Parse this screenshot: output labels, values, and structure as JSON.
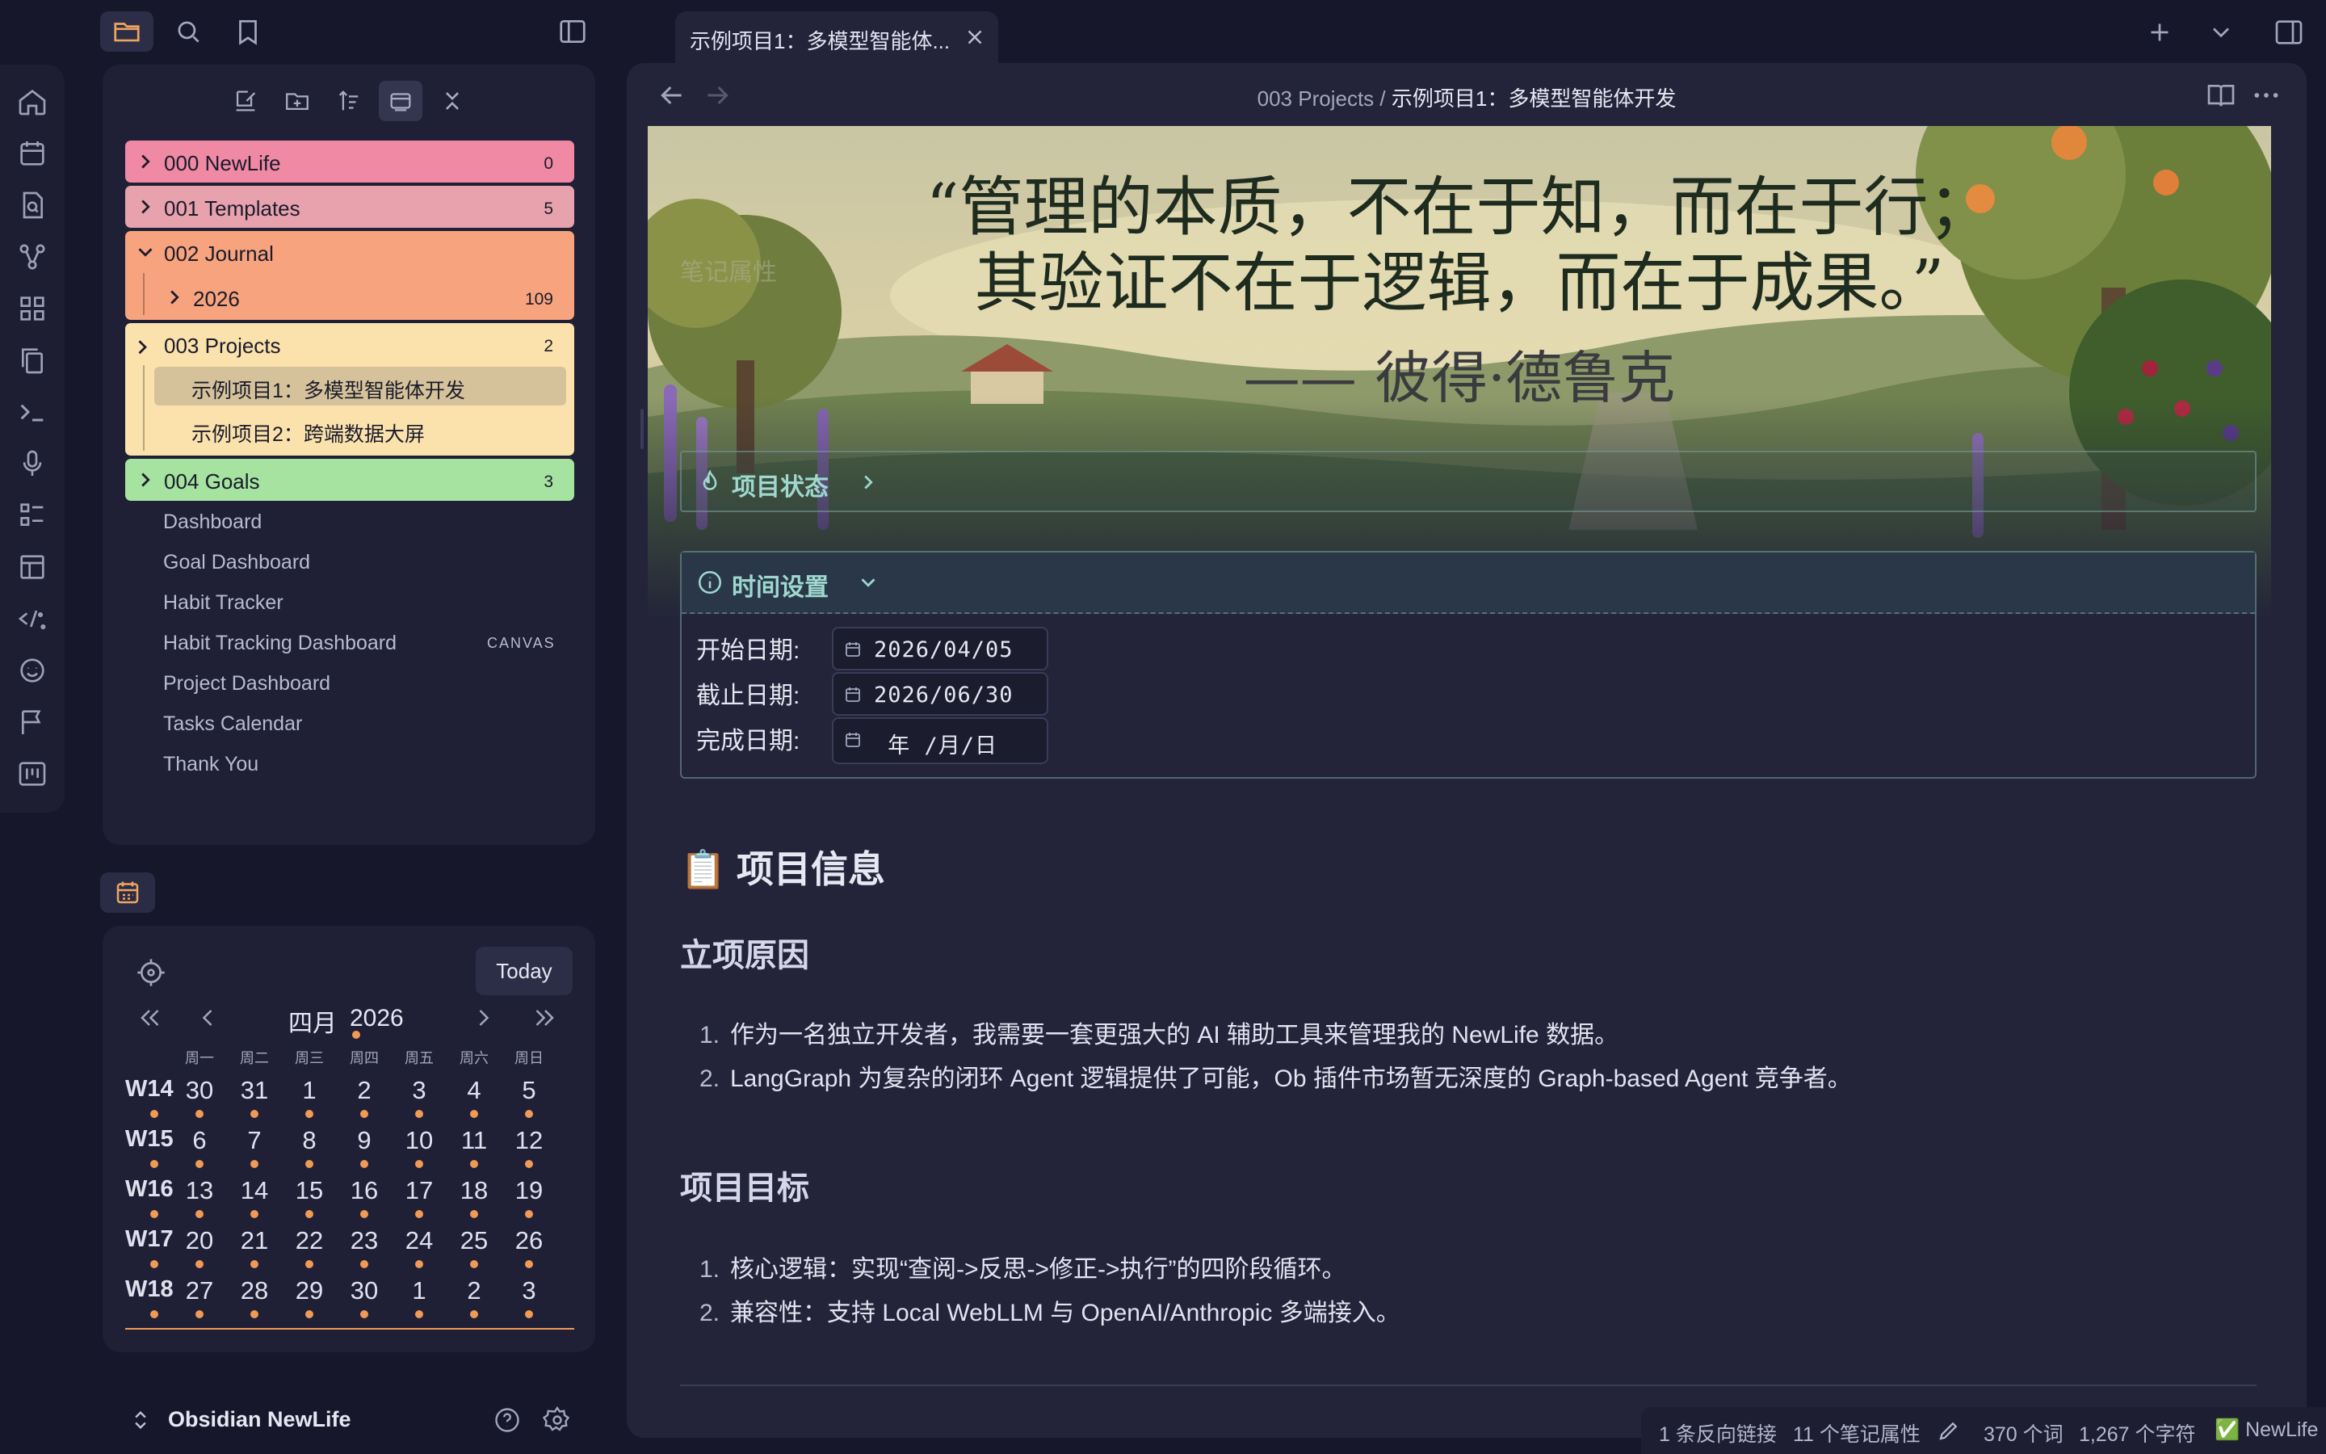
{
  "tab": {
    "title": "示例项目1：多模型智能体...",
    "close_label": "×"
  },
  "breadcrumb": {
    "folder": "003 Projects",
    "separator": "/",
    "note": "示例项目1：多模型智能体开发"
  },
  "explorer": {
    "folders": [
      {
        "name": "000 NewLife",
        "count": "0",
        "color": "#f089a4"
      },
      {
        "name": "001 Templates",
        "count": "5",
        "color": "#e8a2ae"
      },
      {
        "name": "002 Journal",
        "count": "",
        "color": "#f7a37e"
      },
      {
        "name": "2026",
        "count": "109",
        "color": "#f7a37e"
      },
      {
        "name": "003 Projects",
        "count": "2",
        "color": "#fbe2ac"
      },
      {
        "name": "004 Goals",
        "count": "3",
        "color": "#a6e2a0"
      }
    ],
    "project_notes": [
      "示例项目1：多模型智能体开发",
      "示例项目2：跨端数据大屏"
    ],
    "files": [
      "Dashboard",
      "Goal Dashboard",
      "Habit Tracker",
      "Habit Tracking Dashboard",
      "Project Dashboard",
      "Tasks Calendar",
      "Thank You"
    ],
    "canvas_tag": "CANVAS"
  },
  "calendar": {
    "today_label": "Today",
    "month": "四月",
    "year": "2026",
    "weekdays": [
      "周一",
      "周二",
      "周三",
      "周四",
      "周五",
      "周六",
      "周日"
    ],
    "weeks": [
      {
        "label": "W14",
        "days": [
          "30",
          "31",
          "1",
          "2",
          "3",
          "4",
          "5"
        ]
      },
      {
        "label": "W15",
        "days": [
          "6",
          "7",
          "8",
          "9",
          "10",
          "11",
          "12"
        ]
      },
      {
        "label": "W16",
        "days": [
          "13",
          "14",
          "15",
          "16",
          "17",
          "18",
          "19"
        ]
      },
      {
        "label": "W17",
        "days": [
          "20",
          "21",
          "22",
          "23",
          "24",
          "25",
          "26"
        ]
      },
      {
        "label": "W18",
        "days": [
          "27",
          "28",
          "29",
          "30",
          "1",
          "2",
          "3"
        ]
      }
    ]
  },
  "vault": {
    "name": "Obsidian NewLife"
  },
  "note": {
    "banner_quote_line1": "“管理的本质，不在于知，而在于行；",
    "banner_quote_line2": "其验证不在于逻辑，而在于成果。”",
    "banner_author": "—— 彼得·德鲁克",
    "banner_faded_label": "笔记属性",
    "status_callout": "项目状态",
    "time_callout": "时间设置",
    "dates": [
      {
        "label": "开始日期:",
        "value": "2026/04/05"
      },
      {
        "label": "截止日期:",
        "value": "2026/06/30"
      },
      {
        "label": "完成日期:",
        "value": " 年 /月/日"
      }
    ],
    "info_heading": "📋 项目信息",
    "reason_heading": "立项原因",
    "reason_items": [
      "作为一名独立开发者，我需要一套更强大的 AI 辅助工具来管理我的 NewLife 数据。",
      "LangGraph 为复杂的闭环 Agent 逻辑提供了可能，Ob 插件市场暂无深度的 Graph-based Agent 竞争者。"
    ],
    "goal_heading": "项目目标",
    "goal_items": [
      "核心逻辑：实现“查阅->反思->修正->执行”的四阶段循环。",
      "兼容性：支持 Local WebLLM 与 OpenAI/Anthropic 多端接入。"
    ]
  },
  "statusbar": {
    "backlinks": "1 条反向链接",
    "properties": "11 个笔记属性",
    "words": "370 个词",
    "chars": "1,267 个字符",
    "vault": "✅ NewLife"
  }
}
